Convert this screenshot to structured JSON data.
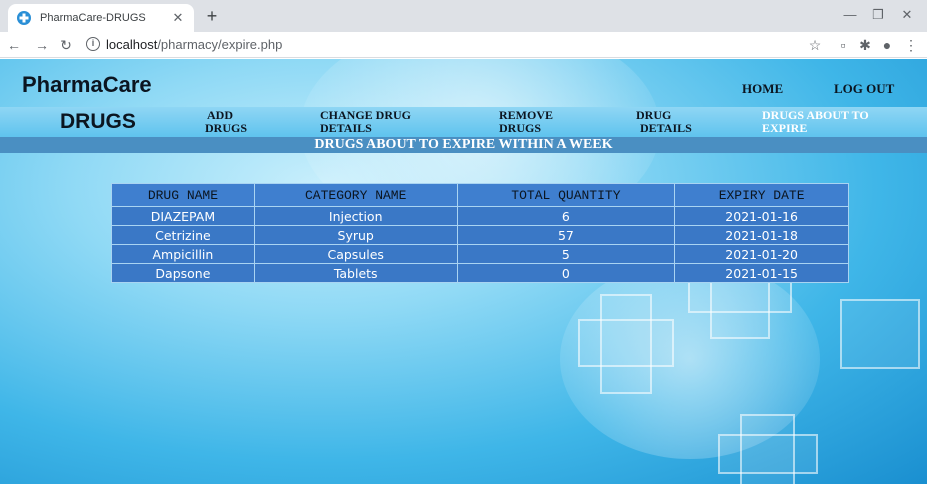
{
  "browser": {
    "tab_title": "PharmaCare-DRUGS",
    "url_host": "localhost",
    "url_path": "/pharmacy/expire.php"
  },
  "header": {
    "brand": "PharmaCare",
    "nav": {
      "home": "HOME",
      "logout": "LOG OUT"
    }
  },
  "drug_nav": {
    "title": "DRUGS",
    "links": [
      {
        "line1": "ADD",
        "line2": "DRUGS"
      },
      {
        "line1": "CHANGE DRUG",
        "line2": "DETAILS"
      },
      {
        "line1": "REMOVE",
        "line2": "DRUGS"
      },
      {
        "line1": "DRUG",
        "line2": "DETAILS"
      },
      {
        "line1": "DRUGS ABOUT TO",
        "line2": "EXPIRE"
      }
    ]
  },
  "banner": "DRUGS ABOUT TO EXPIRE WITHIN A WEEK",
  "table": {
    "headers": [
      "DRUG NAME",
      "CATEGORY NAME",
      "TOTAL QUANTITY",
      "EXPIRY DATE"
    ],
    "rows": [
      [
        "DIAZEPAM",
        "Injection",
        "6",
        "2021-01-16"
      ],
      [
        "Cetrizine",
        "Syrup",
        "57",
        "2021-01-18"
      ],
      [
        "Ampicillin",
        "Capsules",
        "5",
        "2021-01-20"
      ],
      [
        "Dapsone",
        "Tablets",
        "0",
        "2021-01-15"
      ]
    ]
  }
}
